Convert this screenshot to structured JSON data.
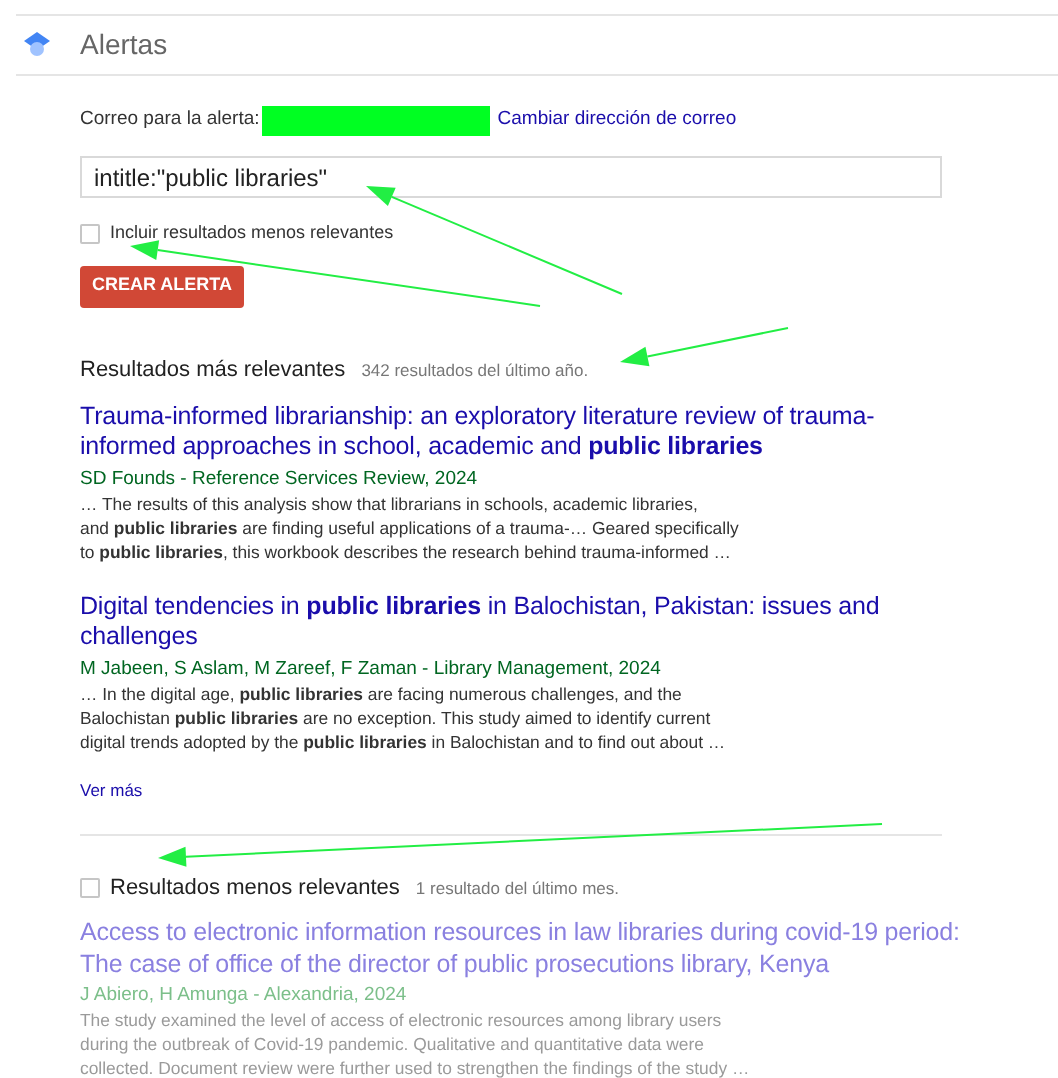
{
  "header": {
    "title": "Alertas"
  },
  "form": {
    "email_label": "Correo para la alerta:",
    "change_email_link": "Cambiar dirección de correo",
    "query": "intitle:\"public libraries\"",
    "include_less_relevant": {
      "label": "Incluir resultados menos relevantes",
      "checked": false
    },
    "create_button": "CREAR ALERTA"
  },
  "sections": [
    {
      "kind": "plain",
      "title": "Resultados más relevantes",
      "count": "342 resultados del último año.",
      "results": [
        {
          "title": "Trauma-informed librarianship: an exploratory literature review of trauma-informed approaches in school, academic and **public libraries**",
          "source": "SD Founds - Reference Services Review, 2024",
          "snippet": [
            "… The results of this analysis show that librarians in schools, academic libraries,",
            "and **public libraries** are finding useful applications of a trauma-… Geared specifically",
            "to **public libraries**, this workbook describes the research behind trauma-informed …"
          ]
        },
        {
          "title": "Digital tendencies in **public libraries** in Balochistan, Pakistan: issues and challenges",
          "source": "M Jabeen, S Aslam, M Zareef, F Zaman - Library Management, 2024",
          "snippet": [
            "… In the digital age, **public libraries** are facing numerous challenges, and the",
            "Balochistan **public libraries** are no exception. This study aimed to identify current",
            "digital trends adopted by the **public libraries** in Balochistan and to find out about …"
          ]
        }
      ],
      "more_link": "Ver más"
    },
    {
      "kind": "checkbox",
      "checked": false,
      "title": "Resultados menos relevantes",
      "count": "1 resultado del último mes.",
      "results": [
        {
          "title": "Access to electronic information resources in law libraries during covid-19 period: The case of office of the director of public prosecutions library, Kenya",
          "source": "J Abiero, H Amunga - Alexandria, 2024",
          "snippet": [
            "The study examined the level of access of electronic resources among library users",
            "during the outbreak of Covid-19 pandemic. Qualitative and quantitative data were",
            "collected. Document review were further used to strengthen the findings of the study …"
          ]
        }
      ]
    }
  ]
}
